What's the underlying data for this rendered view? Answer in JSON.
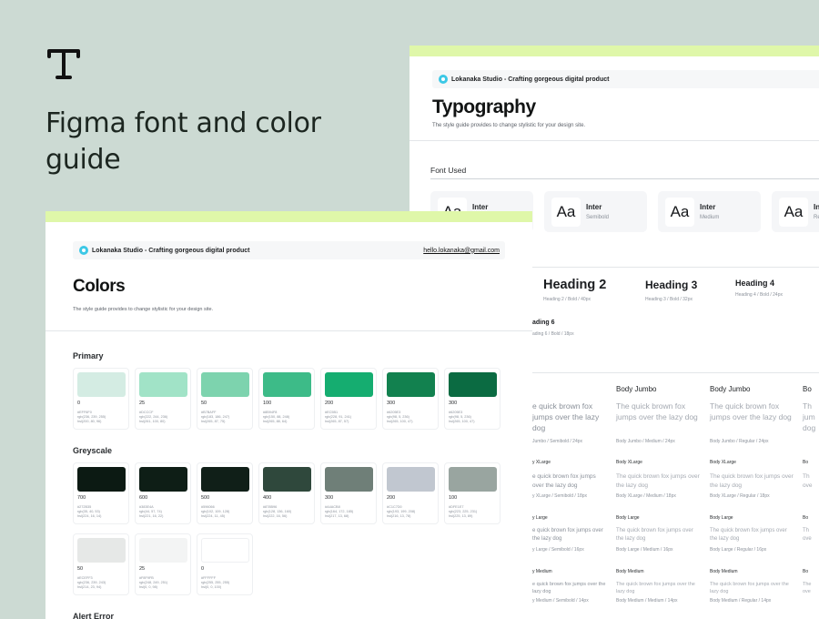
{
  "hero": {
    "title": "Figma font and color guide",
    "logo_icon": "typography-t-icon"
  },
  "brand": {
    "name": "Lokanaka Studio - Crafting gorgeous digital product",
    "email": "hello.lokanaka@gmail.com",
    "accent": "#3cc8e6"
  },
  "typography": {
    "title": "Typography",
    "subtitle": "The style guide provides to change stylistic for your design site.",
    "font_used": "Font Used",
    "fonts": [
      {
        "aa": "Aa",
        "name": "Inter",
        "weight": ""
      },
      {
        "aa": "Aa",
        "name": "Inter",
        "weight": "Semibold"
      },
      {
        "aa": "Aa",
        "name": "Inter",
        "weight": "Medium"
      },
      {
        "aa": "Aa",
        "name": "In",
        "weight": "Re"
      }
    ],
    "headings": [
      {
        "label": "Heading 2",
        "meta": "Heading 2 / Bold / 40px"
      },
      {
        "label": "Heading 3",
        "meta": "Heading 3 / Bold / 32px"
      },
      {
        "label": "Heading 4",
        "meta": "Heading 4 / Bold / 24px"
      },
      {
        "label": "ading 6",
        "meta": "ading 6 / Bold / 18px"
      }
    ],
    "body": {
      "jumbo": {
        "col1": {
          "head": "",
          "text": "e quick brown fox jumps over the lazy dog",
          "meta": "Jumbo / Semibold / 24px"
        },
        "col2": {
          "head": "Body Jumbo",
          "text": "The quick brown fox jumps over the lazy dog",
          "meta": "Body Jumbo / Medium / 24px"
        },
        "col3": {
          "head": "Body Jumbo",
          "text": "The quick brown fox jumps over the lazy dog",
          "meta": "Body Jumbo / Regular / 24px"
        },
        "col4": {
          "head": "Bo",
          "text": "Th jum dog"
        }
      },
      "xlarge": {
        "col1": {
          "head": "y XLarge",
          "text": "e quick brown fox jumps over the lazy dog",
          "meta": "y XLarge / Semibold / 18px"
        },
        "col2": {
          "head": "Body XLarge",
          "text": "The quick brown fox jumps over the lazy dog",
          "meta": "Body XLarge / Medium / 18px"
        },
        "col3": {
          "head": "Body XLarge",
          "text": "The quick brown fox jumps over the lazy dog",
          "meta": "Body XLarge / Regular / 18px"
        },
        "col4": {
          "head": "Bo",
          "text": "Th ove"
        }
      },
      "large": {
        "col1": {
          "head": "y Large",
          "text": "e quick brown fox jumps over the lazy dog",
          "meta": "y Large / Semibold / 16px"
        },
        "col2": {
          "head": "Body Large",
          "text": "The quick brown fox jumps over the lazy dog",
          "meta": "Body Large / Medium / 16px"
        },
        "col3": {
          "head": "Body Large",
          "text": "The quick brown fox jumps over the lazy dog",
          "meta": "Body Large / Regular / 16px"
        },
        "col4": {
          "head": "Bo",
          "text": "Th ove"
        }
      },
      "medium": {
        "col1": {
          "head": "y Medium",
          "text": "e quick brown fox jumps over the lazy dog",
          "meta": "y Medium / Semibold / 14px"
        },
        "col2": {
          "head": "Body Medium",
          "text": "The quick brown fox jumps over the lazy dog",
          "meta": "Body Medium / Medium / 14px"
        },
        "col3": {
          "head": "Body Medium",
          "text": "The quick brown fox jumps over the lazy dog",
          "meta": "Body Medium / Regular / 14px"
        },
        "col4": {
          "head": "Bo",
          "text": "The ove"
        }
      }
    }
  },
  "colors": {
    "title": "Colors",
    "subtitle": "The style guide provides to change stylistic for your design site.",
    "primary_label": "Primary",
    "greyscale_label": "Greyscale",
    "alert_label": "Alert Error",
    "primary": [
      {
        "label": "0",
        "color": "#d4ece3",
        "hex": "#EFF6F0",
        "rgb": "rgb(236, 239, 255)",
        "hsl": "hsl(200, 80, 96)"
      },
      {
        "label": "25",
        "color": "#a1e3c7",
        "hex": "#DCCCF",
        "rgb": "rgb(222, 244, 236)",
        "hsl": "hsl(261, 100, 80)"
      },
      {
        "label": "50",
        "color": "#7dd3ae",
        "hex": "#B7BAFF",
        "rgb": "rgb(183, 186, 247)",
        "hsl": "hsl(265, 87, 75)"
      },
      {
        "label": "100",
        "color": "#3dbb88",
        "hex": "#8B94F8",
        "rgb": "rgb(150, 88, 248)",
        "hsl": "hsl(265, 88, 64)"
      },
      {
        "label": "200",
        "color": "#15ad70",
        "hex": "#EC5B1",
        "rgb": "rgb(228, 91, 241)",
        "hsl": "hsl(265, 87, 57)"
      },
      {
        "label": "300",
        "color": "#12814f",
        "hex": "#6205E3",
        "rgb": "rgb(98, 5, 236)",
        "hsl": "hsl(265, 100, 47)"
      },
      {
        "label": "300",
        "color": "#0b6b42",
        "hex": "#6205E3",
        "rgb": "rgb(98, 5, 236)",
        "hsl": "hsl(265, 100, 47)"
      }
    ],
    "greyscale": [
      {
        "label": "700",
        "color": "#0c1a13",
        "hex": "#272B35",
        "rgb": "rgb(35, 40, 53)",
        "hsl": "hsl(224, 16, 14)"
      },
      {
        "label": "600",
        "color": "#0e1e16",
        "hex": "#383E4A",
        "rgb": "rgb(44, 57, 74)",
        "hsl": "hsl(221, 16, 22)"
      },
      {
        "label": "500",
        "color": "#101f18",
        "hex": "#596066",
        "rgb": "rgb(102, 109, 128)",
        "hsl": "hsl(224, 11, 45)"
      },
      {
        "label": "400",
        "color": "#2f483c",
        "hex": "#878B96",
        "rgb": "rgb(128, 136, 160)",
        "hsl": "hsl(222, 16, 56)"
      },
      {
        "label": "300",
        "color": "#6f7f78",
        "hex": "#A4ACB8",
        "rgb": "rgb(164, 172, 185)",
        "hsl": "hsl(217, 13, 68)"
      },
      {
        "label": "200",
        "color": "#c1c7d0",
        "hex": "#C1C7D0",
        "rgb": "rgb(193, 199, 208)",
        "hsl": "hsl(216, 13, 78)"
      },
      {
        "label": "100",
        "color": "#99a5a0",
        "hex": "#DFE1E7",
        "rgb": "rgb(223, 225, 231)",
        "hsl": "hsl(225, 13, 89)"
      }
    ],
    "greyscale2": [
      {
        "label": "50",
        "color": "#e6e8e7",
        "hex": "#ECEFF3",
        "rgb": "rgb(236, 239, 243)",
        "hsl": "hsl(214, 23, 94)"
      },
      {
        "label": "25",
        "color": "#f3f4f4",
        "hex": "#F8F9FB",
        "rgb": "rgb(248, 249, 251)",
        "hsl": "hsl(0, 0, 98)"
      },
      {
        "label": "0",
        "color": "#ffffff",
        "hex": "#FFFFFF",
        "rgb": "rgb(255, 255, 255)",
        "hsl": "hsl(0, 0, 100)"
      }
    ]
  }
}
